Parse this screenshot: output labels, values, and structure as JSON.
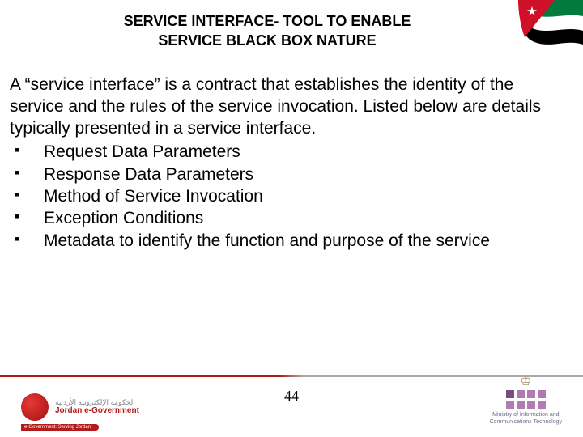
{
  "title_line1": "SERVICE INTERFACE- TOOL TO ENABLE",
  "title_line2": "SERVICE BLACK BOX NATURE",
  "intro": "A “service interface” is a contract that establishes the identity of the service and the rules of the service invocation. Listed below are details typically presented in a service interface.",
  "bullets": [
    "Request Data Parameters",
    "Response Data Parameters",
    "Method of Service Invocation",
    "Exception Conditions",
    "Metadata to identify the function and purpose of the service"
  ],
  "page_number": "44",
  "footer_left": {
    "ar": "الحكومة الإلكترونية الأردنية",
    "en": "Jordan e-Government",
    "tagline": "e-Government: Serving Jordan"
  },
  "footer_right": {
    "line1": "Ministry of Information and",
    "line2": "Communications Technology"
  }
}
